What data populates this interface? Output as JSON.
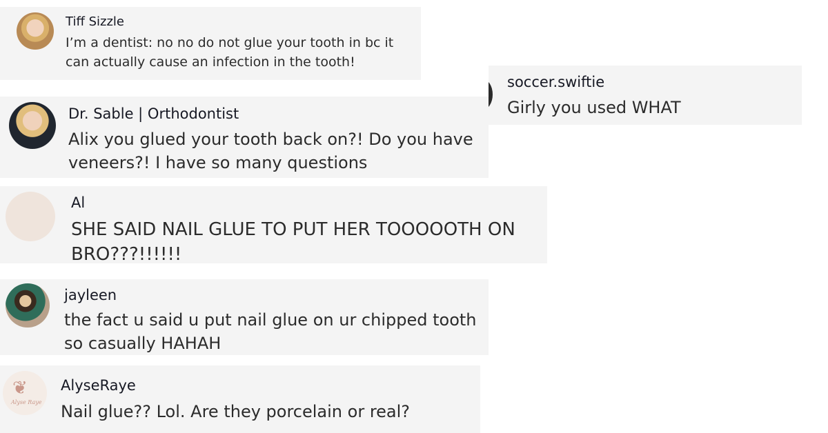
{
  "comments": [
    {
      "username": "Tiff Sizzle",
      "text": "I’m a dentist: no no do not glue your tooth in bc it can actually cause an infection in the tooth!"
    },
    {
      "username": "soccer.swiftie",
      "text": "Girly you used WHAT"
    },
    {
      "username": "Dr. Sable | Orthodontist",
      "text": "Alix you glued your tooth back on?! Do you have veneers?! I have so many questions"
    },
    {
      "username": "Al",
      "text": "SHE SAID NAIL GLUE TO PUT HER TOOOOOTH ON BRO???!!!!!!"
    },
    {
      "username": "jayleen",
      "text": "the fact u said u put nail glue on ur chipped tooth so casually HAHAH"
    },
    {
      "username": "AlyseRaye",
      "text": "Nail glue?? Lol. Are they porcelain or real?",
      "avatar_signature": "Alyse Raye"
    }
  ],
  "colors": {
    "card_background": "#f4f4f4",
    "text": "#161823"
  }
}
